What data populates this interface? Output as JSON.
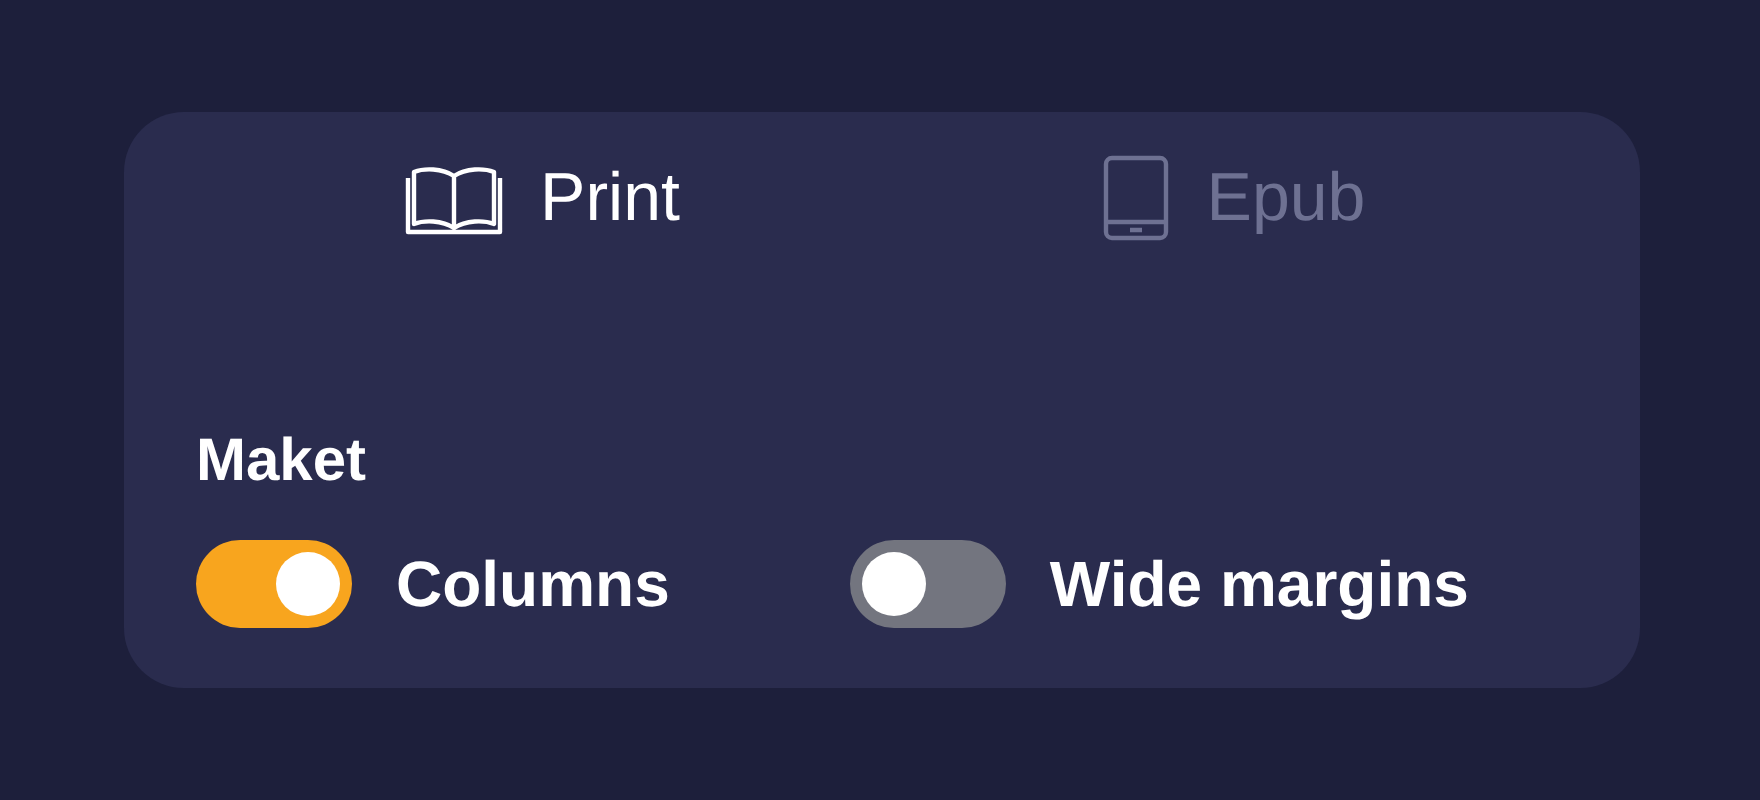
{
  "tabs": [
    {
      "label": "Print",
      "kind": "book",
      "selected": true
    },
    {
      "label": "Epub",
      "kind": "tablet",
      "selected": false
    }
  ],
  "section": {
    "title": "Maket"
  },
  "toggles": [
    {
      "label": "Columns",
      "on": true
    },
    {
      "label": "Wide margins",
      "on": false
    }
  ]
}
